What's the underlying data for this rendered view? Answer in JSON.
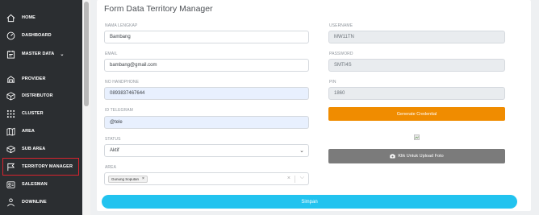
{
  "sidebar": {
    "items": [
      {
        "label": "HOME",
        "icon": "home-icon"
      },
      {
        "label": "DASHBOARD",
        "icon": "dashboard-icon"
      },
      {
        "label": "MASTER DATA",
        "icon": "master-data-icon"
      },
      {
        "label": "PROVIDER",
        "icon": "provider-icon"
      },
      {
        "label": "DISTRIBUTOR",
        "icon": "distributor-icon"
      },
      {
        "label": "CLUSTER",
        "icon": "cluster-icon"
      },
      {
        "label": "AREA",
        "icon": "map-icon"
      },
      {
        "label": "SUB AREA",
        "icon": "sub-area-icon"
      },
      {
        "label": "TERRITORY MANAGER",
        "icon": "flag-icon"
      },
      {
        "label": "SALESMAN",
        "icon": "salesman-icon"
      },
      {
        "label": "DOWNLINE",
        "icon": "downline-icon"
      }
    ],
    "master_chevron": "⌄",
    "active_item": "TERRITORY MANAGER"
  },
  "form": {
    "title": "Form Data Territory Manager",
    "nama_label": "NAMA LENGKAP",
    "nama_value": "Bambang",
    "email_label": "EMAIL",
    "email_value": "bambang@gmail.com",
    "hp_label": "NO HANDPHONE",
    "hp_value": "0893837467644",
    "telegram_label": "ID TELEGRAM",
    "telegram_value": "@tele",
    "status_label": "STATUS",
    "status_value": "Aktif",
    "area_label": "AREA",
    "area_tag": "Gunung Soputan",
    "area_tag_remove": "×",
    "area_clear": "×",
    "area_dropdown": "⌵",
    "username_label": "USERNAME",
    "username_value": "MW11TN",
    "password_label": "PASSWORD",
    "password_value": "SMTI4S",
    "pin_label": "PIN",
    "pin_value": "1860",
    "generate_label": "Generate Credential",
    "upload_label": "Klik Untuk Upload Foto",
    "submit_label": "Simpan"
  },
  "colors": {
    "sidebar_bg": "#2b2e31",
    "highlight_border": "#d9232e",
    "generate_btn": "#f08c00",
    "upload_btn": "#7b7b7b",
    "submit_btn": "#22c3ef",
    "autofill_bg": "#e8f0fe"
  }
}
